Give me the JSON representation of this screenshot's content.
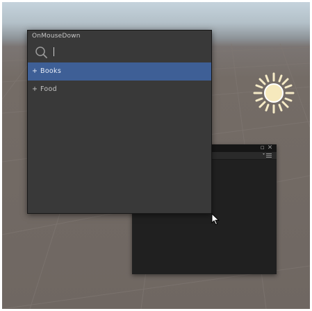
{
  "popup": {
    "title": "OnMouseDown",
    "search": {
      "value": "",
      "placeholder": ""
    },
    "items": [
      {
        "prefix": "+",
        "label": "Books",
        "selected": true
      },
      {
        "prefix": "+",
        "label": "Food",
        "selected": false
      }
    ]
  },
  "background_window": {
    "maximize_glyph": "▫",
    "close_glyph": "✕"
  },
  "colors": {
    "popup_bg": "#393939",
    "selected_row": "#3e5f96",
    "dark_window": "#202020",
    "sun": "#f6ebc7"
  },
  "icons": [
    "search-icon",
    "sun-icon",
    "menu-icon",
    "mouse-cursor-icon"
  ]
}
